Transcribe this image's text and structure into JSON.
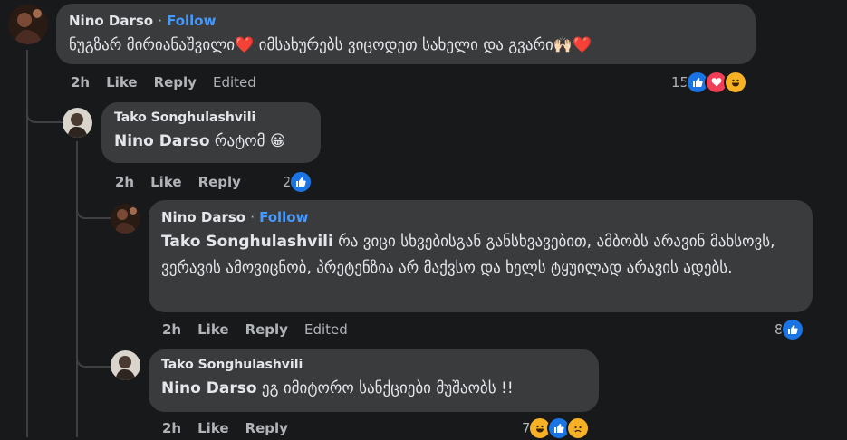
{
  "comments": [
    {
      "author": "Nino Darso",
      "follow_sep": "·",
      "follow_label": "Follow",
      "body": "ნუგზარ მირიანაშვილი❤️ იმსახურებს ვიცოდეთ სახელი და გვარი🙌🏻❤️",
      "time": "2h",
      "like_label": "Like",
      "reply_label": "Reply",
      "edited_label": "Edited",
      "reaction_count": "15",
      "reactions": [
        "like-icon",
        "love-icon",
        "haha-icon"
      ]
    },
    {
      "author": "Tako Songhulashvili",
      "mention": "Nino Darso",
      "body": " რატომ 😀",
      "time": "2h",
      "like_label": "Like",
      "reply_label": "Reply",
      "reaction_count": "2",
      "reactions": [
        "like-icon"
      ]
    },
    {
      "author": "Nino Darso",
      "follow_sep": "·",
      "follow_label": "Follow",
      "mention": "Tako Songhulashvili",
      "body": " რა ვიცი სხვებისგან განსხვავებით, ამბობს არავინ მახსოვს, ვერავის ამოვიცნობ, პრეტენზია არ მაქვსო და ხელს ტყუილად არავის ადებს.",
      "time": "2h",
      "like_label": "Like",
      "reply_label": "Reply",
      "edited_label": "Edited",
      "reaction_count": "8",
      "reactions": [
        "like-icon"
      ]
    },
    {
      "author": "Tako Songhulashvili",
      "mention": "Nino Darso",
      "body": " ეგ იმიტორო სანქციები მუშაობს !!",
      "time": "2h",
      "like_label": "Like",
      "reply_label": "Reply",
      "reaction_count": "7",
      "reactions": [
        "haha-icon",
        "like-icon",
        "sad-icon"
      ]
    }
  ],
  "colors": {
    "background": "#18191a",
    "bubble": "#3a3b3c",
    "follow": "#4599ff",
    "muted": "#b0b3b8",
    "like": "#1b74e4",
    "love": "#f33e58",
    "haha": "#f7b125"
  }
}
